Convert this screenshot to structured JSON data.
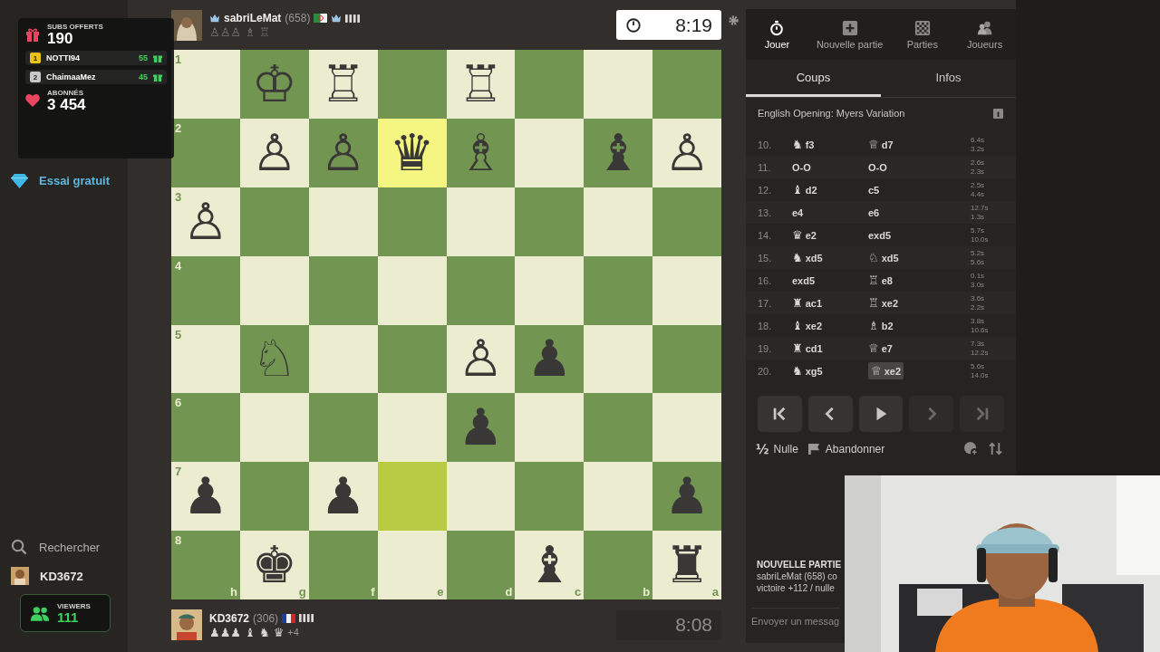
{
  "stream_overlay": {
    "subs": {
      "label": "SUBS OFFERTS",
      "count": "190"
    },
    "leaders": [
      {
        "rank": "1",
        "name": "NOTTI94",
        "count": "55",
        "color": "#e8c21a"
      },
      {
        "rank": "2",
        "name": "ChaimaaMez",
        "count": "45",
        "color": "#c8c8c8"
      }
    ],
    "followers": {
      "label": "ABONNÉS",
      "count": "3 454"
    },
    "viewers": {
      "label": "VIEWERS",
      "count": "111"
    }
  },
  "sidebar": {
    "items": [
      {
        "label": "Essai gratuit",
        "kind": "promo"
      },
      {
        "label": "Rechercher",
        "kind": "search"
      },
      {
        "label": "KD3672",
        "kind": "user"
      }
    ]
  },
  "top_player": {
    "name": "sabriLeMat",
    "rating": "(658)",
    "captured": "♙♙♙ ♗ ♖",
    "clock": "8:19",
    "clock_active": true
  },
  "bottom_player": {
    "name": "KD3672",
    "rating": "(306)",
    "captured": "♟♟♟ ♝ ♞ ♛",
    "advantage": "+4",
    "clock": "8:08",
    "clock_active": false
  },
  "board": {
    "ranks": [
      {
        "label": "1",
        "cells": [
          {
            "highlight": false
          },
          {
            "piece": "♔",
            "highlight": false
          },
          {
            "piece": "♖",
            "highlight": false
          },
          {
            "highlight": false
          },
          {
            "piece": "♖",
            "highlight": false
          },
          {
            "highlight": false
          },
          {
            "highlight": false
          },
          {
            "highlight": false
          }
        ]
      },
      {
        "label": "2",
        "cells": [
          {
            "highlight": false
          },
          {
            "piece": "♙",
            "highlight": false
          },
          {
            "piece": "♙",
            "highlight": false
          },
          {
            "piece": "♛",
            "highlight": true
          },
          {
            "piece": "♗",
            "highlight": false
          },
          {
            "highlight": false
          },
          {
            "piece": "♝",
            "highlight": false
          },
          {
            "piece": "♙",
            "highlight": false
          }
        ]
      },
      {
        "label": "3",
        "cells": [
          {
            "piece": "♙",
            "highlight": false
          },
          {
            "highlight": false
          },
          {
            "highlight": false
          },
          {
            "highlight": false
          },
          {
            "highlight": false
          },
          {
            "highlight": false
          },
          {
            "highlight": false
          },
          {
            "highlight": false
          }
        ]
      },
      {
        "label": "4",
        "cells": [
          {
            "highlight": false
          },
          {
            "highlight": false
          },
          {
            "highlight": false
          },
          {
            "highlight": false
          },
          {
            "highlight": false
          },
          {
            "highlight": false
          },
          {
            "highlight": false
          },
          {
            "highlight": false
          }
        ]
      },
      {
        "label": "5",
        "cells": [
          {
            "highlight": false
          },
          {
            "piece": "♘",
            "highlight": false
          },
          {
            "highlight": false
          },
          {
            "highlight": false
          },
          {
            "piece": "♙",
            "highlight": false
          },
          {
            "piece": "♟",
            "highlight": false
          },
          {
            "highlight": false
          },
          {
            "highlight": false
          }
        ]
      },
      {
        "label": "6",
        "cells": [
          {
            "highlight": false
          },
          {
            "highlight": false
          },
          {
            "highlight": false
          },
          {
            "highlight": false
          },
          {
            "piece": "♟",
            "highlight": false
          },
          {
            "highlight": false
          },
          {
            "highlight": false
          },
          {
            "highlight": false
          }
        ]
      },
      {
        "label": "7",
        "cells": [
          {
            "piece": "♟",
            "highlight": false
          },
          {
            "highlight": false
          },
          {
            "piece": "♟",
            "highlight": false
          },
          {
            "highlight": true
          },
          {
            "highlight": false
          },
          {
            "highlight": false
          },
          {
            "highlight": false
          },
          {
            "piece": "♟",
            "highlight": false
          }
        ]
      },
      {
        "label": "8",
        "cells": [
          {
            "file": "h",
            "highlight": false
          },
          {
            "file": "g",
            "piece": "♚",
            "highlight": false
          },
          {
            "file": "f",
            "highlight": false
          },
          {
            "file": "e",
            "highlight": false
          },
          {
            "file": "d",
            "highlight": false
          },
          {
            "file": "c",
            "piece": "♝",
            "highlight": false
          },
          {
            "file": "b",
            "highlight": false
          },
          {
            "file": "a",
            "piece": "♜",
            "highlight": false
          }
        ]
      }
    ]
  },
  "panel": {
    "nav": [
      {
        "label": "Jouer",
        "kind": "play",
        "selected": true
      },
      {
        "label": "Nouvelle partie",
        "kind": "new",
        "selected": false
      },
      {
        "label": "Parties",
        "kind": "games",
        "selected": false
      },
      {
        "label": "Joueurs",
        "kind": "players",
        "selected": false
      }
    ],
    "tabs": [
      {
        "label": "Coups",
        "selected": true
      },
      {
        "label": "Infos",
        "selected": false
      }
    ],
    "opening": "English Opening: Myers Variation",
    "moves": [
      {
        "number": "10.",
        "white": {
          "icon": "♞",
          "san": "f3",
          "selected": false
        },
        "black": {
          "icon": "♕",
          "san": "d7",
          "selected": false
        },
        "white_time": "6.4s",
        "black_time": "3.2s"
      },
      {
        "number": "11.",
        "white": {
          "san": "O-O",
          "selected": false
        },
        "black": {
          "san": "O-O",
          "selected": false
        },
        "white_time": "2.6s",
        "black_time": "2.3s"
      },
      {
        "number": "12.",
        "white": {
          "icon": "♝",
          "san": "d2",
          "selected": false
        },
        "black": {
          "san": "c5",
          "selected": false
        },
        "white_time": "2.5s",
        "black_time": "4.4s"
      },
      {
        "number": "13.",
        "white": {
          "san": "e4",
          "selected": false
        },
        "black": {
          "san": "e6",
          "selected": false
        },
        "white_time": "12.7s",
        "black_time": "1.3s"
      },
      {
        "number": "14.",
        "white": {
          "icon": "♛",
          "san": "e2",
          "selected": false
        },
        "black": {
          "san": "exd5",
          "selected": false
        },
        "white_time": "5.7s",
        "black_time": "10.0s"
      },
      {
        "number": "15.",
        "white": {
          "icon": "♞",
          "san": "xd5",
          "selected": false
        },
        "black": {
          "icon": "♘",
          "san": "xd5",
          "selected": false
        },
        "white_time": "5.2s",
        "black_time": "5.6s"
      },
      {
        "number": "16.",
        "white": {
          "san": "exd5",
          "selected": false
        },
        "black": {
          "icon": "♖",
          "san": "e8",
          "selected": false
        },
        "white_time": "0.1s",
        "black_time": "3.0s"
      },
      {
        "number": "17.",
        "white": {
          "icon": "♜",
          "san": "ac1",
          "selected": false
        },
        "black": {
          "icon": "♖",
          "san": "xe2",
          "selected": false
        },
        "white_time": "3.6s",
        "black_time": "2.2s"
      },
      {
        "number": "18.",
        "white": {
          "icon": "♝",
          "san": "xe2",
          "selected": false
        },
        "black": {
          "icon": "♗",
          "san": "b2",
          "selected": false
        },
        "white_time": "3.8s",
        "black_time": "10.6s"
      },
      {
        "number": "19.",
        "white": {
          "icon": "♜",
          "san": "cd1",
          "selected": false
        },
        "black": {
          "icon": "♕",
          "san": "e7",
          "selected": false
        },
        "white_time": "7.3s",
        "black_time": "12.2s"
      },
      {
        "number": "20.",
        "white": {
          "icon": "♞",
          "san": "xg5",
          "selected": false
        },
        "black": {
          "icon": "♕",
          "san": "xe2",
          "selected": true
        },
        "white_time": "5.6s",
        "black_time": "14.0s"
      }
    ],
    "controls": [
      {
        "kind": "first",
        "disabled": false
      },
      {
        "kind": "prev",
        "disabled": false
      },
      {
        "kind": "play",
        "disabled": false
      },
      {
        "kind": "next",
        "disabled": true
      },
      {
        "kind": "last",
        "disabled": true
      }
    ],
    "actions": [
      {
        "kind": "draw",
        "icon": "½",
        "label": "Nulle"
      },
      {
        "kind": "resign",
        "label": "Abandonner"
      }
    ],
    "chat": {
      "title": "NOUVELLE PARTIE",
      "lines": [
        "sabriLeMat (658) co",
        "victoire +112 / nulle"
      ],
      "placeholder": "Envoyer un messag"
    }
  }
}
